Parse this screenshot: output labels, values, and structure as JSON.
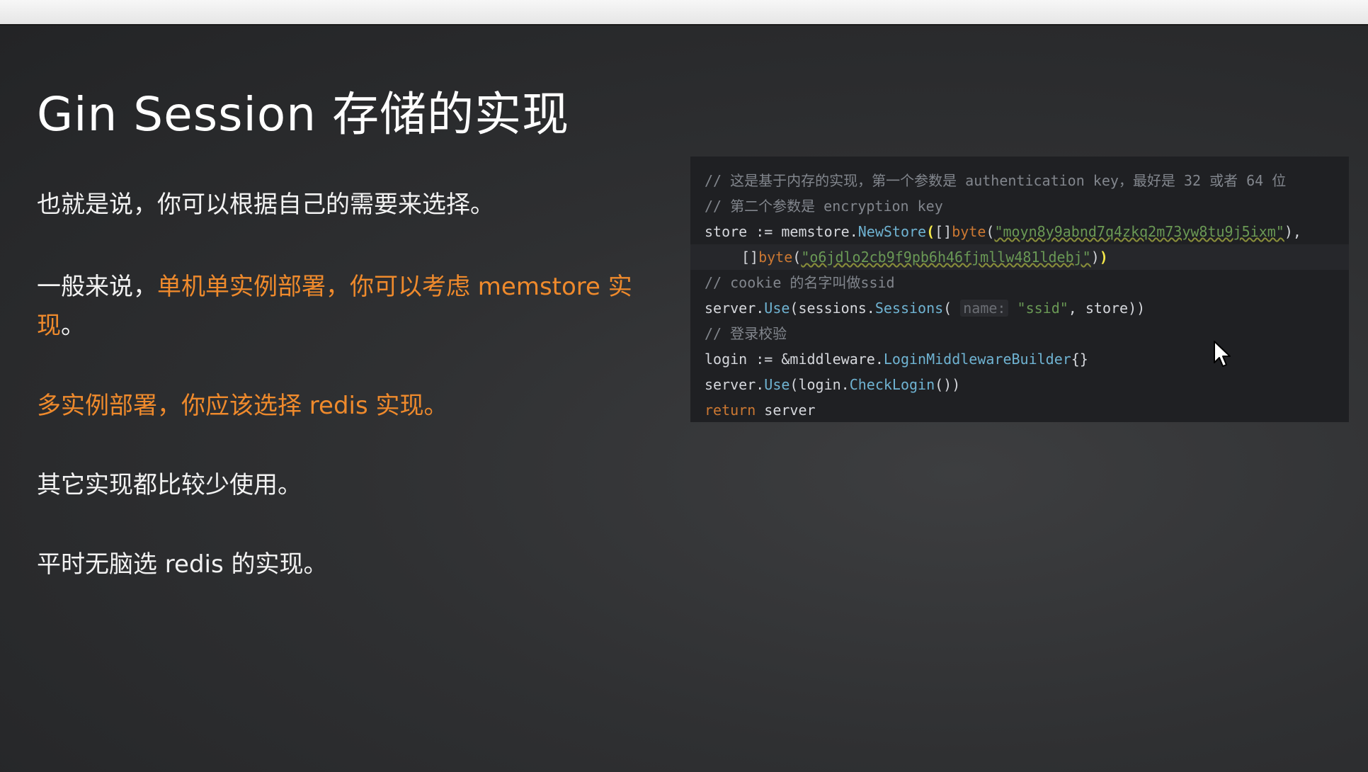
{
  "slide": {
    "title": "Gin Session 存储的实现",
    "p1": "也就是说，你可以根据自己的需要来选择。",
    "p2_prefix": "一般来说，",
    "p2_highlight": "单机单实例部署，你可以考虑 memstore 实现",
    "p2_suffix": "。",
    "p3": "多实例部署，你应该选择 redis 实现。",
    "p4": "其它实现都比较少使用。",
    "p5": "平时无脑选 redis 的实现。"
  },
  "code": {
    "c1": "// 这是基于内存的实现，第一个参数是 authentication key，最好是 32 或者 64 位",
    "c2": "// 第二个参数是 encryption key",
    "l3_a": "store := ",
    "l3_b": "memstore.",
    "l3_fn": "NewStore",
    "l3_open": "(",
    "l3_c": "[]",
    "l3_kw": "byte",
    "l3_d": "(",
    "l3_str": "\"moyn8y9abnd7q4zkq2m73yw8tu9j5ixm\"",
    "l3_e": "),",
    "l4_a": "[]",
    "l4_kw": "byte",
    "l4_b": "(",
    "l4_str": "\"o6jdlo2cb9f9pb6h46fjmllw481ldebj\"",
    "l4_c": ")",
    "l4_close": ")",
    "c5": "// cookie 的名字叫做ssid",
    "l6_a": "server.",
    "l6_fn": "Use",
    "l6_b": "(sessions.",
    "l6_fn2": "Sessions",
    "l6_c": "( ",
    "l6_hint": "name:",
    "l6_str": "\"ssid\"",
    "l6_d": ", store))",
    "c7": "// 登录校验",
    "l8_a": "login := &middleware.",
    "l8_fn": "LoginMiddlewareBuilder",
    "l8_b": "{}",
    "l9_a": "server.",
    "l9_fn": "Use",
    "l9_b": "(login.",
    "l9_fn2": "CheckLogin",
    "l9_c": "())",
    "l10_kw": "return",
    "l10_a": " server"
  },
  "icons": {
    "cursor": "mouse-pointer-icon"
  },
  "colors": {
    "highlight": "#ef8a2c",
    "background": "#2b2c2e",
    "code_bg": "#1f2023"
  }
}
